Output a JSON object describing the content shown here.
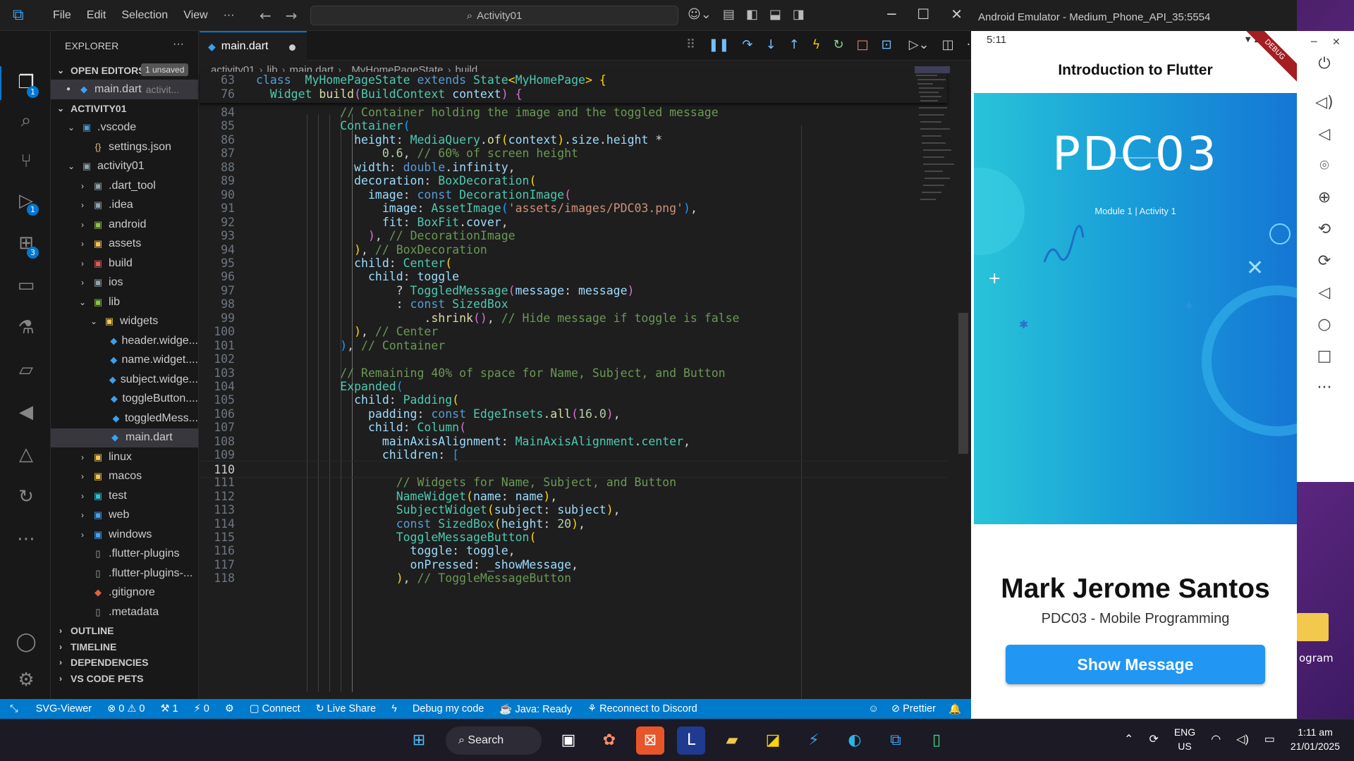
{
  "vscode": {
    "menu": [
      "File",
      "Edit",
      "Selection",
      "View",
      "···"
    ],
    "command_center": "Activity01",
    "sidebar_title": "EXPLORER",
    "open_editors": {
      "label": "OPEN EDITORS",
      "badge": "1 unsaved",
      "file": "main.dart",
      "path": "activit..."
    },
    "workspace": "ACTIVITY01",
    "tree": [
      {
        "label": ".vscode",
        "chev": "⌄",
        "icon": "▣",
        "color": "#4a9cd6"
      },
      {
        "label": "settings.json",
        "chev": "",
        "icon": "{}",
        "color": "#e2c08d"
      },
      {
        "label": "activity01",
        "chev": "⌄",
        "icon": "▣",
        "color": "#90a4ae"
      },
      {
        "label": ".dart_tool",
        "chev": "›",
        "icon": "▣",
        "color": "#90a4ae"
      },
      {
        "label": ".idea",
        "chev": "›",
        "icon": "▣",
        "color": "#90a4ae"
      },
      {
        "label": "android",
        "chev": "›",
        "icon": "▣",
        "color": "#8bc34a"
      },
      {
        "label": "assets",
        "chev": "›",
        "icon": "▣",
        "color": "#f9c74f"
      },
      {
        "label": "build",
        "chev": "›",
        "icon": "▣",
        "color": "#e05a5a"
      },
      {
        "label": "ios",
        "chev": "›",
        "icon": "▣",
        "color": "#90a4ae"
      },
      {
        "label": "lib",
        "chev": "⌄",
        "icon": "▣",
        "color": "#8bc34a"
      },
      {
        "label": "widgets",
        "chev": "⌄",
        "icon": "▣",
        "color": "#f9c74f"
      },
      {
        "label": "header.widge...",
        "chev": "",
        "icon": "◆",
        "color": "#3ba0f0"
      },
      {
        "label": "name.widget....",
        "chev": "",
        "icon": "◆",
        "color": "#3ba0f0"
      },
      {
        "label": "subject.widge...",
        "chev": "",
        "icon": "◆",
        "color": "#3ba0f0"
      },
      {
        "label": "toggleButton....",
        "chev": "",
        "icon": "◆",
        "color": "#3ba0f0"
      },
      {
        "label": "toggledMess...",
        "chev": "",
        "icon": "◆",
        "color": "#3ba0f0"
      },
      {
        "label": "main.dart",
        "chev": "",
        "icon": "◆",
        "color": "#3ba0f0"
      },
      {
        "label": "linux",
        "chev": "›",
        "icon": "▣",
        "color": "#f9c74f"
      },
      {
        "label": "macos",
        "chev": "›",
        "icon": "▣",
        "color": "#f9c74f"
      },
      {
        "label": "test",
        "chev": "›",
        "icon": "▣",
        "color": "#26c6da"
      },
      {
        "label": "web",
        "chev": "›",
        "icon": "▣",
        "color": "#42a5f5"
      },
      {
        "label": "windows",
        "chev": "›",
        "icon": "▣",
        "color": "#42a5f5"
      },
      {
        "label": ".flutter-plugins",
        "chev": "",
        "icon": "▯",
        "color": "#aaa"
      },
      {
        "label": ".flutter-plugins-...",
        "chev": "",
        "icon": "▯",
        "color": "#aaa"
      },
      {
        "label": ".gitignore",
        "chev": "",
        "icon": "◆",
        "color": "#e0623b"
      },
      {
        "label": ".metadata",
        "chev": "",
        "icon": "▯",
        "color": "#aaa"
      }
    ],
    "panels": [
      "OUTLINE",
      "TIMELINE",
      "DEPENDENCIES",
      "VS CODE PETS"
    ],
    "tab": "main.dart",
    "breadcrumb": [
      "activity01",
      "lib",
      "main.dart",
      "_MyHomePageState",
      "build"
    ],
    "sticky_lines": [
      {
        "n": "63",
        "html": "<span class=\"k\">class</span> <span class=\"c\">_MyHomePageState</span> <span class=\"k\">extends</span> <span class=\"c\">State</span><span class=\"y\">&lt;</span><span class=\"c\">MyHomePage</span><span class=\"y\">&gt;</span> <span class=\"y\">{</span>"
      },
      {
        "n": "76",
        "html": "  <span class=\"c\">Widget</span> <span class=\"f\">build</span><span class=\"pk\">(</span><span class=\"c\">BuildContext</span> <span class=\"p\">context</span><span class=\"pk\">)</span> <span class=\"pk\">{</span>"
      }
    ],
    "code_lines": [
      {
        "n": "84",
        "html": "            <span class=\"cm\">// Container holding the image and the toggled message</span>"
      },
      {
        "n": "85",
        "html": "            <span class=\"c\">Container</span><span class=\"b\">(</span>"
      },
      {
        "n": "86",
        "html": "              <span class=\"p\">height</span>: <span class=\"c\">MediaQuery</span>.<span class=\"f\">of</span><span class=\"y\">(</span><span class=\"p\">context</span><span class=\"y\">)</span>.<span class=\"p\">size</span>.<span class=\"p\">height</span> *"
      },
      {
        "n": "87",
        "html": "                  <span class=\"n\">0.6</span>, <span class=\"cm\">// 60% of screen height</span>"
      },
      {
        "n": "88",
        "html": "              <span class=\"p\">width</span>: <span class=\"k\">double</span>.<span class=\"p\">infinity</span>,"
      },
      {
        "n": "89",
        "html": "              <span class=\"p\">decoration</span>: <span class=\"c\">BoxDecoration</span><span class=\"y\">(</span>"
      },
      {
        "n": "90",
        "html": "                <span class=\"p\">image</span>: <span class=\"k\">const</span> <span class=\"c\">DecorationImage</span><span class=\"pk\">(</span>"
      },
      {
        "n": "91",
        "html": "                  <span class=\"p\">image</span>: <span class=\"c\">AssetImage</span><span class=\"b\">(</span><span class=\"s\">'assets/images/PDC03.png'</span><span class=\"b\">)</span>,"
      },
      {
        "n": "92",
        "html": "                  <span class=\"p\">fit</span>: <span class=\"c\">BoxFit</span>.<span class=\"p\">cover</span>,"
      },
      {
        "n": "93",
        "html": "                <span class=\"pk\">)</span>, <span class=\"cm\">// DecorationImage</span>"
      },
      {
        "n": "94",
        "html": "              <span class=\"y\">)</span>, <span class=\"cm\">// BoxDecoration</span>"
      },
      {
        "n": "95",
        "html": "              <span class=\"p\">child</span>: <span class=\"c\">Center</span><span class=\"y\">(</span>"
      },
      {
        "n": "96",
        "html": "                <span class=\"p\">child</span>: <span class=\"p\">toggle</span>"
      },
      {
        "n": "97",
        "html": "                    ? <span class=\"c\">ToggledMessage</span><span class=\"pk\">(</span><span class=\"p\">message</span>: <span class=\"p\">message</span><span class=\"pk\">)</span>"
      },
      {
        "n": "98",
        "html": "                    : <span class=\"k\">const</span> <span class=\"c\">SizedBox</span>"
      },
      {
        "n": "99",
        "html": "                        .<span class=\"f\">shrink</span><span class=\"pk\">()</span>, <span class=\"cm\">// Hide message if toggle is false</span>"
      },
      {
        "n": "100",
        "html": "              <span class=\"y\">)</span>, <span class=\"cm\">// Center</span>"
      },
      {
        "n": "101",
        "html": "            <span class=\"b\">)</span>, <span class=\"cm\">// Container</span>"
      },
      {
        "n": "102",
        "html": ""
      },
      {
        "n": "103",
        "html": "            <span class=\"cm\">// Remaining 40% of space for Name, Subject, and Button</span>"
      },
      {
        "n": "104",
        "html": "            <span class=\"c\">Expanded</span><span class=\"b\">(</span>"
      },
      {
        "n": "105",
        "html": "              <span class=\"p\">child</span>: <span class=\"c\">Padding</span><span class=\"y\">(</span>"
      },
      {
        "n": "106",
        "html": "                <span class=\"p\">padding</span>: <span class=\"k\">const</span> <span class=\"c\">EdgeInsets</span>.<span class=\"f\">all</span><span class=\"pk\">(</span><span class=\"n\">16.0</span><span class=\"pk\">)</span>,"
      },
      {
        "n": "107",
        "html": "                <span class=\"p\">child</span>: <span class=\"c\">Column</span><span class=\"pk\">(</span>"
      },
      {
        "n": "108",
        "html": "                  <span class=\"p\">mainAxisAlignment</span>: <span class=\"c\">MainAxisAlignment</span>.<span class=\"c\">center</span>,"
      },
      {
        "n": "109",
        "html": "                  <span class=\"p\">children</span>: <span class=\"b\">[</span>"
      },
      {
        "n": "110",
        "html": ""
      },
      {
        "n": "111",
        "html": "                    <span class=\"cm\">// Widgets for Name, Subject, and Button</span>"
      },
      {
        "n": "112",
        "html": "                    <span class=\"c\">NameWidget</span><span class=\"y\">(</span><span class=\"p\">name</span>: <span class=\"p\">name</span><span class=\"y\">)</span>,"
      },
      {
        "n": "113",
        "html": "                    <span class=\"c\">SubjectWidget</span><span class=\"y\">(</span><span class=\"p\">subject</span>: <span class=\"p\">subject</span><span class=\"y\">)</span>,"
      },
      {
        "n": "114",
        "html": "                    <span class=\"k\">const</span> <span class=\"c\">SizedBox</span><span class=\"y\">(</span><span class=\"p\">height</span>: <span class=\"n\">20</span><span class=\"y\">)</span>,"
      },
      {
        "n": "115",
        "html": "                    <span class=\"c\">ToggleMessageButton</span><span class=\"y\">(</span>"
      },
      {
        "n": "116",
        "html": "                      <span class=\"p\">toggle</span>: <span class=\"p\">toggle</span>,"
      },
      {
        "n": "117",
        "html": "                      <span class=\"p\">onPressed</span>: <span class=\"p\">_showMessage</span>,"
      },
      {
        "n": "118",
        "html": "                    <span class=\"y\">)</span>, <span class=\"cm\">// ToggleMessageButton</span>"
      }
    ],
    "current_line": "110",
    "status": {
      "remote": "⤡",
      "items": [
        "SVG-Viewer",
        "⊗ 0 ⚠ 0",
        "⚒ 1",
        "⚡︎ 0",
        "⚙",
        "▢ Connect",
        "↻ Live Share",
        "ϟ",
        "Debug my code",
        "☕ Java: Ready",
        "⚘ Reconnect to Discord"
      ],
      "right": [
        "☺",
        "⊘ Prettier",
        "🔔"
      ]
    }
  },
  "emulator": {
    "window_title": "Android Emulator - Medium_Phone_API_35:5554",
    "time": "5:11",
    "debug": "DEBUG",
    "app_title": "Introduction to Flutter",
    "banner_title": "PDC03",
    "banner_subtitle": "Module 1 | Activity 1",
    "name": "Mark Jerome Santos",
    "subject": "PDC03 - Mobile Programming",
    "button": "Show Message"
  },
  "desktop": {
    "folder_label": "ogram"
  },
  "taskbar": {
    "search": "Search",
    "lang_top": "ENG",
    "lang_bottom": "US",
    "time": "1:11 am",
    "date": "21/01/2025"
  }
}
